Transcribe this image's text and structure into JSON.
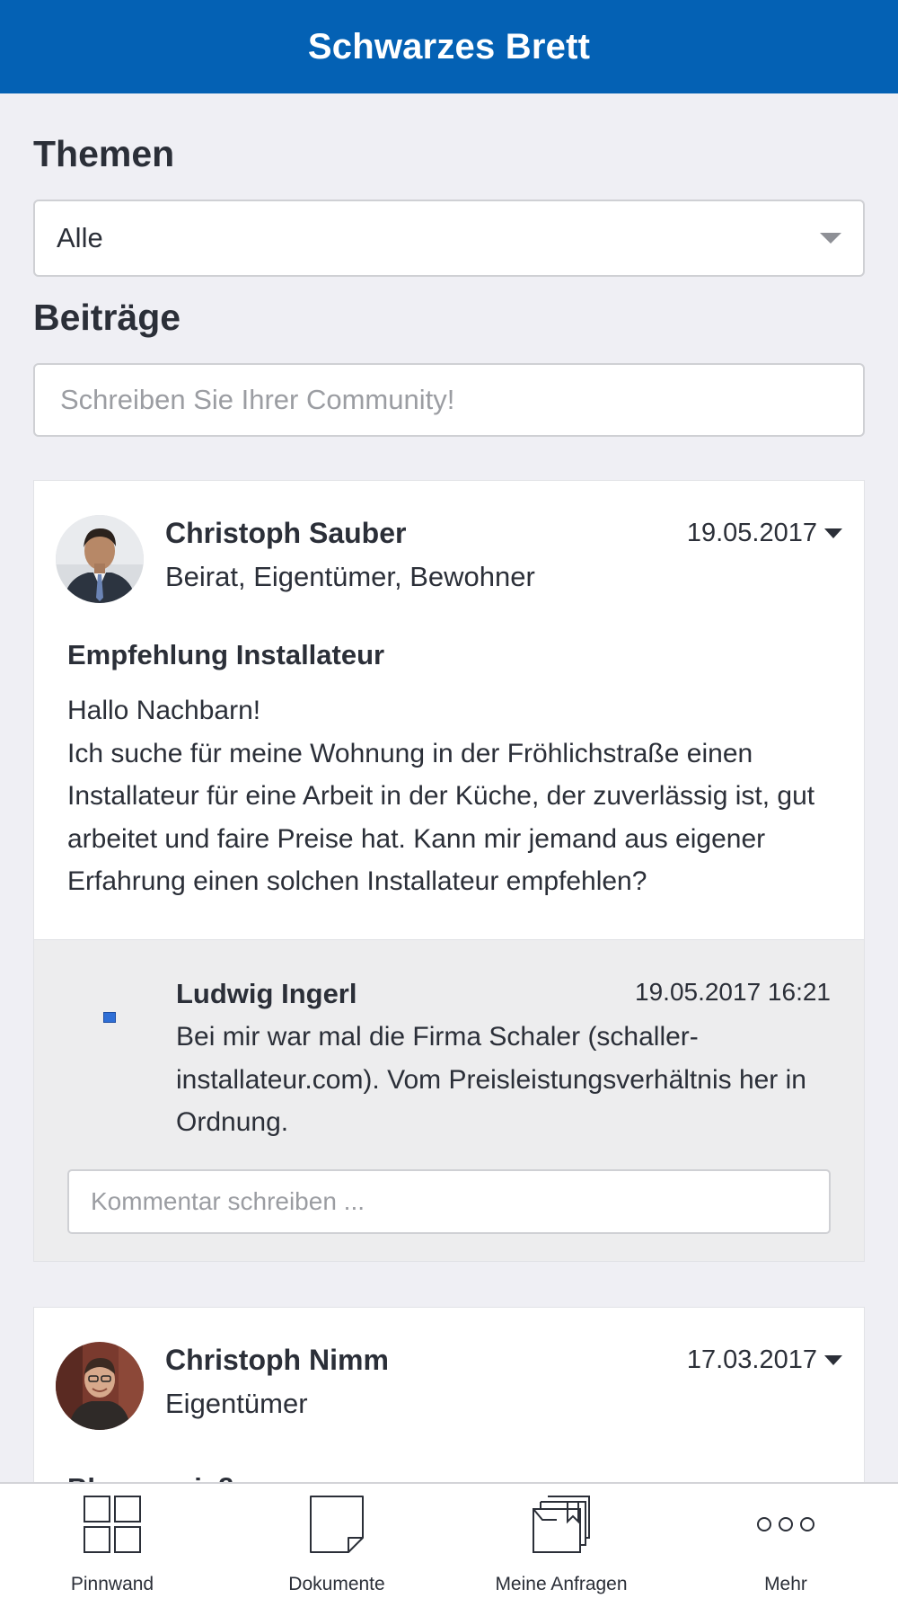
{
  "header": {
    "title": "Schwarzes Brett"
  },
  "filters": {
    "topics_heading": "Themen",
    "topics_selected": "Alle",
    "posts_heading": "Beiträge",
    "compose_placeholder": "Schreiben Sie Ihrer Community!"
  },
  "posts": [
    {
      "author": "Christoph Sauber",
      "role": "Beirat, Eigentümer, Bewohner",
      "date": "19.05.2017",
      "title": "Empfehlung Installateur",
      "body_lines": [
        "Hallo Nachbarn!",
        "Ich suche für meine Wohnung in der Fröhlichstraße einen Installateur für eine Arbeit in der Küche, der zuverlässig ist, gut arbeitet und faire Preise hat. Kann mir jemand aus eigener Erfahrung einen solchen Installateur empfehlen?"
      ],
      "comments": [
        {
          "author": "Ludwig Ingerl",
          "date": "19.05.2017 16:21",
          "text": "Bei mir war mal die Firma Schaler (schaller-installateur.com). Vom Preisleistungsverhältnis her in Ordnung."
        }
      ],
      "comment_placeholder": "Kommentar schreiben ..."
    },
    {
      "author": "Christoph Nimm",
      "role": "Eigentümer",
      "date": "17.03.2017",
      "title": "Blumen gießen"
    }
  ],
  "tabbar": {
    "items": [
      {
        "label": "Pinnwand",
        "icon": "grid-icon"
      },
      {
        "label": "Dokumente",
        "icon": "document-icon"
      },
      {
        "label": "Meine Anfragen",
        "icon": "folders-icon"
      },
      {
        "label": "Mehr",
        "icon": "more-icon"
      }
    ]
  },
  "colors": {
    "header": "#0461b4",
    "background": "#efeff4",
    "text": "#2b2f38"
  }
}
